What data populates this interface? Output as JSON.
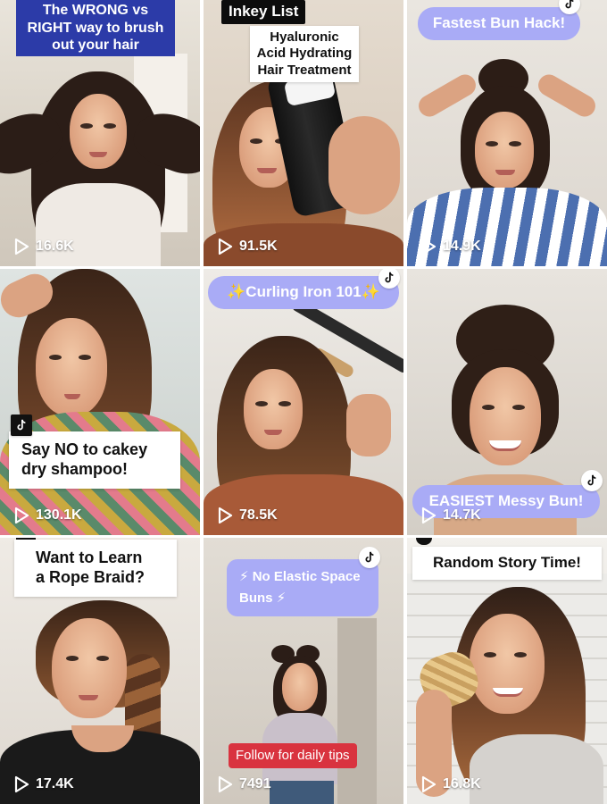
{
  "tiles": [
    {
      "caption": "The WRONG vs RIGHT way to brush out your hair",
      "views": "16.6K"
    },
    {
      "caption": "Inkey List",
      "caption2": "Hyaluronic Acid Hydrating Hair Treatment",
      "views": "91.5K"
    },
    {
      "caption": "Fastest Bun Hack!",
      "views": "14.9K"
    },
    {
      "caption": "Say NO to cakey dry shampoo!",
      "views": "130.1K"
    },
    {
      "caption": "✨Curling Iron 101✨",
      "views": "78.5K"
    },
    {
      "caption": "EASIEST Messy Bun!",
      "views": "14.7K"
    },
    {
      "caption": "Want to Learn a Rope Braid?",
      "views": "17.4K"
    },
    {
      "caption": "⚡ No Elastic Space Buns ⚡",
      "caption2": "Follow for daily tips",
      "views": "7491"
    },
    {
      "caption": "Random Story Time!",
      "views": "16.8K"
    }
  ],
  "icons": {
    "play": "play-icon",
    "tiktok": "tiktok-logo-icon"
  },
  "colors": {
    "caption_blue": "#2c3ba8",
    "caption_purple": "#a9abf6",
    "caption_red": "#d9333f"
  }
}
